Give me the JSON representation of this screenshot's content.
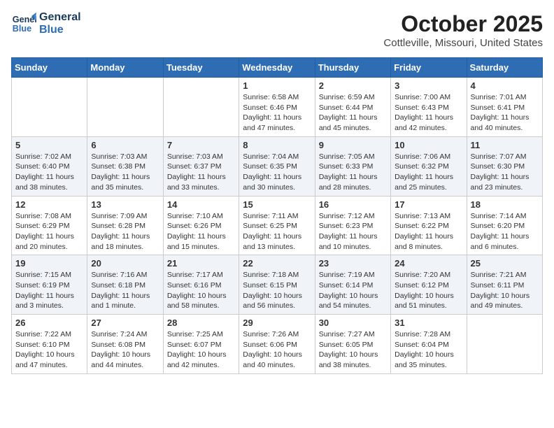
{
  "logo": {
    "line1": "General",
    "line2": "Blue"
  },
  "title": "October 2025",
  "subtitle": "Cottleville, Missouri, United States",
  "weekdays": [
    "Sunday",
    "Monday",
    "Tuesday",
    "Wednesday",
    "Thursday",
    "Friday",
    "Saturday"
  ],
  "weeks": [
    [
      {
        "day": "",
        "info": ""
      },
      {
        "day": "",
        "info": ""
      },
      {
        "day": "",
        "info": ""
      },
      {
        "day": "1",
        "info": "Sunrise: 6:58 AM\nSunset: 6:46 PM\nDaylight: 11 hours\nand 47 minutes."
      },
      {
        "day": "2",
        "info": "Sunrise: 6:59 AM\nSunset: 6:44 PM\nDaylight: 11 hours\nand 45 minutes."
      },
      {
        "day": "3",
        "info": "Sunrise: 7:00 AM\nSunset: 6:43 PM\nDaylight: 11 hours\nand 42 minutes."
      },
      {
        "day": "4",
        "info": "Sunrise: 7:01 AM\nSunset: 6:41 PM\nDaylight: 11 hours\nand 40 minutes."
      }
    ],
    [
      {
        "day": "5",
        "info": "Sunrise: 7:02 AM\nSunset: 6:40 PM\nDaylight: 11 hours\nand 38 minutes."
      },
      {
        "day": "6",
        "info": "Sunrise: 7:03 AM\nSunset: 6:38 PM\nDaylight: 11 hours\nand 35 minutes."
      },
      {
        "day": "7",
        "info": "Sunrise: 7:03 AM\nSunset: 6:37 PM\nDaylight: 11 hours\nand 33 minutes."
      },
      {
        "day": "8",
        "info": "Sunrise: 7:04 AM\nSunset: 6:35 PM\nDaylight: 11 hours\nand 30 minutes."
      },
      {
        "day": "9",
        "info": "Sunrise: 7:05 AM\nSunset: 6:33 PM\nDaylight: 11 hours\nand 28 minutes."
      },
      {
        "day": "10",
        "info": "Sunrise: 7:06 AM\nSunset: 6:32 PM\nDaylight: 11 hours\nand 25 minutes."
      },
      {
        "day": "11",
        "info": "Sunrise: 7:07 AM\nSunset: 6:30 PM\nDaylight: 11 hours\nand 23 minutes."
      }
    ],
    [
      {
        "day": "12",
        "info": "Sunrise: 7:08 AM\nSunset: 6:29 PM\nDaylight: 11 hours\nand 20 minutes."
      },
      {
        "day": "13",
        "info": "Sunrise: 7:09 AM\nSunset: 6:28 PM\nDaylight: 11 hours\nand 18 minutes."
      },
      {
        "day": "14",
        "info": "Sunrise: 7:10 AM\nSunset: 6:26 PM\nDaylight: 11 hours\nand 15 minutes."
      },
      {
        "day": "15",
        "info": "Sunrise: 7:11 AM\nSunset: 6:25 PM\nDaylight: 11 hours\nand 13 minutes."
      },
      {
        "day": "16",
        "info": "Sunrise: 7:12 AM\nSunset: 6:23 PM\nDaylight: 11 hours\nand 10 minutes."
      },
      {
        "day": "17",
        "info": "Sunrise: 7:13 AM\nSunset: 6:22 PM\nDaylight: 11 hours\nand 8 minutes."
      },
      {
        "day": "18",
        "info": "Sunrise: 7:14 AM\nSunset: 6:20 PM\nDaylight: 11 hours\nand 6 minutes."
      }
    ],
    [
      {
        "day": "19",
        "info": "Sunrise: 7:15 AM\nSunset: 6:19 PM\nDaylight: 11 hours\nand 3 minutes."
      },
      {
        "day": "20",
        "info": "Sunrise: 7:16 AM\nSunset: 6:18 PM\nDaylight: 11 hours\nand 1 minute."
      },
      {
        "day": "21",
        "info": "Sunrise: 7:17 AM\nSunset: 6:16 PM\nDaylight: 10 hours\nand 58 minutes."
      },
      {
        "day": "22",
        "info": "Sunrise: 7:18 AM\nSunset: 6:15 PM\nDaylight: 10 hours\nand 56 minutes."
      },
      {
        "day": "23",
        "info": "Sunrise: 7:19 AM\nSunset: 6:14 PM\nDaylight: 10 hours\nand 54 minutes."
      },
      {
        "day": "24",
        "info": "Sunrise: 7:20 AM\nSunset: 6:12 PM\nDaylight: 10 hours\nand 51 minutes."
      },
      {
        "day": "25",
        "info": "Sunrise: 7:21 AM\nSunset: 6:11 PM\nDaylight: 10 hours\nand 49 minutes."
      }
    ],
    [
      {
        "day": "26",
        "info": "Sunrise: 7:22 AM\nSunset: 6:10 PM\nDaylight: 10 hours\nand 47 minutes."
      },
      {
        "day": "27",
        "info": "Sunrise: 7:24 AM\nSunset: 6:08 PM\nDaylight: 10 hours\nand 44 minutes."
      },
      {
        "day": "28",
        "info": "Sunrise: 7:25 AM\nSunset: 6:07 PM\nDaylight: 10 hours\nand 42 minutes."
      },
      {
        "day": "29",
        "info": "Sunrise: 7:26 AM\nSunset: 6:06 PM\nDaylight: 10 hours\nand 40 minutes."
      },
      {
        "day": "30",
        "info": "Sunrise: 7:27 AM\nSunset: 6:05 PM\nDaylight: 10 hours\nand 38 minutes."
      },
      {
        "day": "31",
        "info": "Sunrise: 7:28 AM\nSunset: 6:04 PM\nDaylight: 10 hours\nand 35 minutes."
      },
      {
        "day": "",
        "info": ""
      }
    ]
  ]
}
